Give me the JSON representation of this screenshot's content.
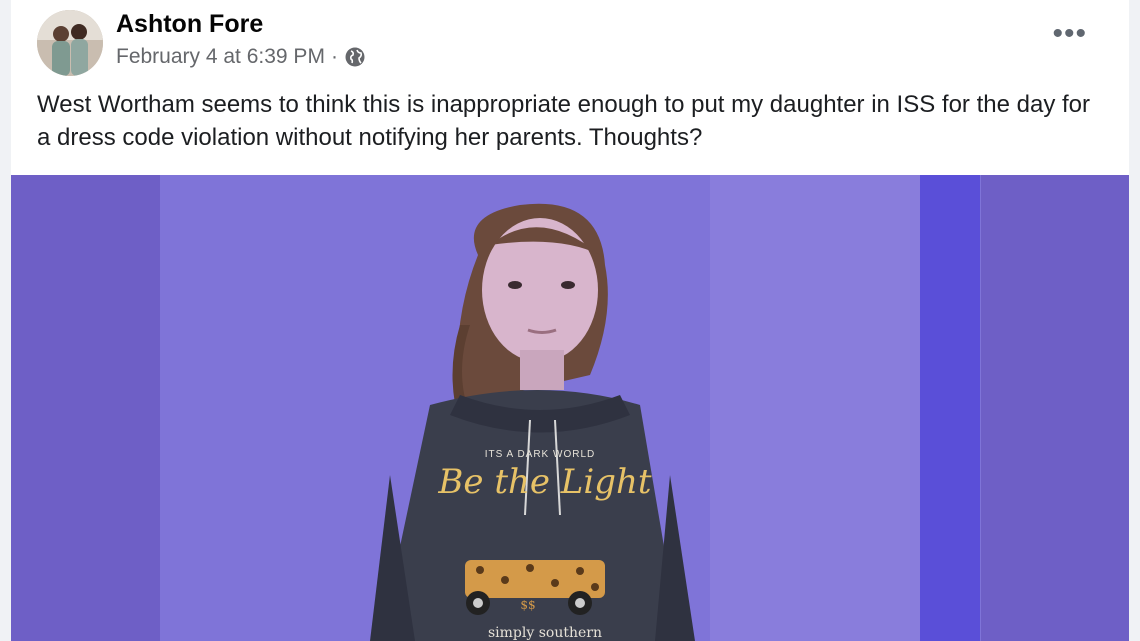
{
  "post": {
    "author": "Ashton Fore",
    "timestamp": "February 4 at 6:39 PM",
    "separator": "·",
    "privacy_icon": "globe-icon",
    "more_icon": "more-options-icon",
    "text": "West Wortham seems to think this is inappropriate enough to put my daughter in ISS for the day for a dress code violation without notifying her parents. Thoughts?"
  },
  "photo": {
    "hoodie_line1": "ITS A DARK WORLD",
    "hoodie_line2": "Be the Light",
    "hoodie_line3": "simply southern"
  },
  "colors": {
    "photo_background": "#6e5fc6",
    "wall": "#7f74d8",
    "hoodie": "#3a3e4c"
  }
}
